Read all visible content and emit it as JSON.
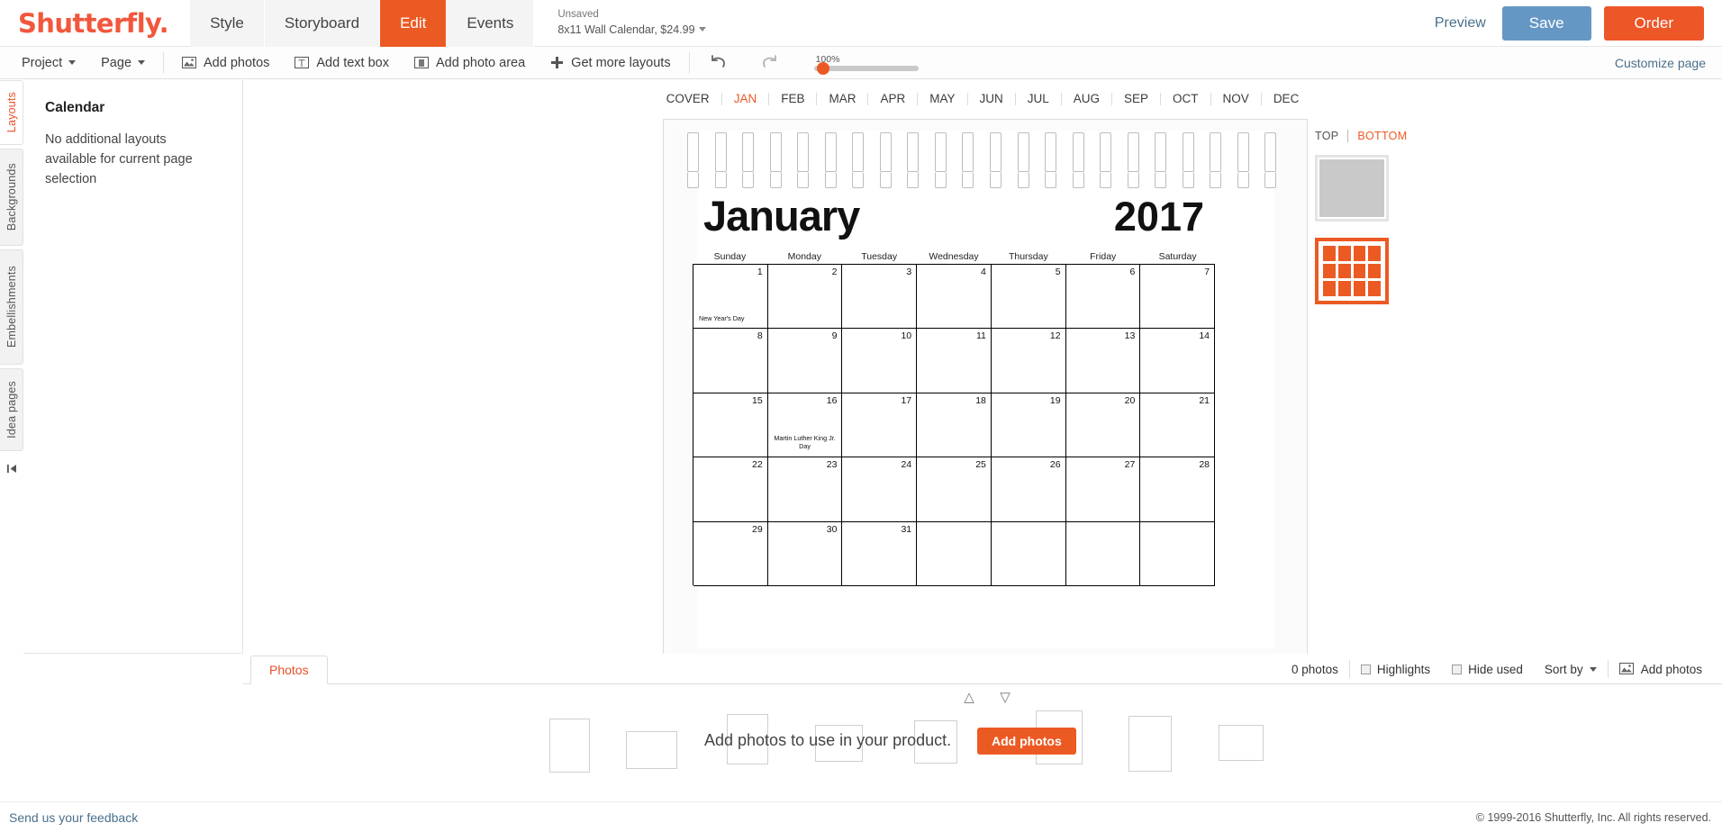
{
  "brand": {
    "name": "Shutterfly."
  },
  "nav": {
    "tabs": [
      {
        "label": "Style",
        "active": false
      },
      {
        "label": "Storyboard",
        "active": false
      },
      {
        "label": "Edit",
        "active": true
      },
      {
        "label": "Events",
        "active": false
      }
    ]
  },
  "project": {
    "status": "Unsaved",
    "details": "8x11 Wall Calendar, $24.99"
  },
  "top_actions": {
    "preview": "Preview",
    "save": "Save",
    "order": "Order"
  },
  "toolbar": {
    "project_menu": "Project",
    "page_menu": "Page",
    "add_photos": "Add photos",
    "add_text_box": "Add text box",
    "add_photo_area": "Add photo area",
    "get_more_layouts": "Get more layouts",
    "undo": "undo-icon",
    "redo": "redo-icon",
    "zoom_level": "100%",
    "customize_page": "Customize page"
  },
  "sidebar": {
    "tabs": [
      {
        "label": "Layouts",
        "active": true
      },
      {
        "label": "Backgrounds",
        "active": false
      },
      {
        "label": "Embellishments",
        "active": false
      },
      {
        "label": "Idea pages",
        "active": false
      }
    ],
    "collapse": "collapse-panel-icon",
    "panel": {
      "title": "Calendar",
      "message": "No additional layouts available for current page selection"
    }
  },
  "month_tabs": [
    {
      "label": "COVER",
      "active": false
    },
    {
      "label": "JAN",
      "active": true
    },
    {
      "label": "FEB",
      "active": false
    },
    {
      "label": "MAR",
      "active": false
    },
    {
      "label": "APR",
      "active": false
    },
    {
      "label": "MAY",
      "active": false
    },
    {
      "label": "JUN",
      "active": false
    },
    {
      "label": "JUL",
      "active": false
    },
    {
      "label": "AUG",
      "active": false
    },
    {
      "label": "SEP",
      "active": false
    },
    {
      "label": "OCT",
      "active": false
    },
    {
      "label": "NOV",
      "active": false
    },
    {
      "label": "DEC",
      "active": false
    }
  ],
  "calendar": {
    "month": "January",
    "year": "2017",
    "weekdays": [
      "Sunday",
      "Monday",
      "Tuesday",
      "Wednesday",
      "Thursday",
      "Friday",
      "Saturday"
    ],
    "weeks": [
      [
        {
          "day": "1",
          "event": "New Year's Day",
          "event_align": "left"
        },
        {
          "day": "2",
          "event": ""
        },
        {
          "day": "3",
          "event": ""
        },
        {
          "day": "4",
          "event": ""
        },
        {
          "day": "5",
          "event": ""
        },
        {
          "day": "6",
          "event": ""
        },
        {
          "day": "7",
          "event": ""
        }
      ],
      [
        {
          "day": "8",
          "event": ""
        },
        {
          "day": "9",
          "event": ""
        },
        {
          "day": "10",
          "event": ""
        },
        {
          "day": "11",
          "event": ""
        },
        {
          "day": "12",
          "event": ""
        },
        {
          "day": "13",
          "event": ""
        },
        {
          "day": "14",
          "event": ""
        }
      ],
      [
        {
          "day": "15",
          "event": ""
        },
        {
          "day": "16",
          "event": "Martin Luther King Jr. Day",
          "event_align": "center"
        },
        {
          "day": "17",
          "event": ""
        },
        {
          "day": "18",
          "event": ""
        },
        {
          "day": "19",
          "event": ""
        },
        {
          "day": "20",
          "event": ""
        },
        {
          "day": "21",
          "event": ""
        }
      ],
      [
        {
          "day": "22",
          "event": ""
        },
        {
          "day": "23",
          "event": ""
        },
        {
          "day": "24",
          "event": ""
        },
        {
          "day": "25",
          "event": ""
        },
        {
          "day": "26",
          "event": ""
        },
        {
          "day": "27",
          "event": ""
        },
        {
          "day": "28",
          "event": ""
        }
      ],
      [
        {
          "day": "29",
          "event": ""
        },
        {
          "day": "30",
          "event": ""
        },
        {
          "day": "31",
          "event": ""
        },
        {
          "day": "",
          "event": ""
        },
        {
          "day": "",
          "event": ""
        },
        {
          "day": "",
          "event": ""
        },
        {
          "day": "",
          "event": ""
        }
      ]
    ]
  },
  "page_sides": {
    "top_label": "TOP",
    "bottom_label": "BOTTOM",
    "active": "BOTTOM"
  },
  "photo_tray": {
    "tab_label": "Photos",
    "count": "0 photos",
    "highlights": "Highlights",
    "hide_used": "Hide used",
    "sort_by": "Sort by",
    "add_photos": "Add photos",
    "message": "Add photos to use in your product.",
    "add_photos_button": "Add photos",
    "scroll_up": "chevron-up-icon",
    "scroll_down": "chevron-down-icon"
  },
  "footer": {
    "feedback": "Send us your feedback",
    "copyright": "© 1999-2016 Shutterfly, Inc. All rights reserved."
  },
  "colors": {
    "brand_orange": "#f1573c",
    "active_tab": "#ec5a24",
    "save_blue": "#6597c4",
    "link_blue": "#4a6f8a"
  }
}
